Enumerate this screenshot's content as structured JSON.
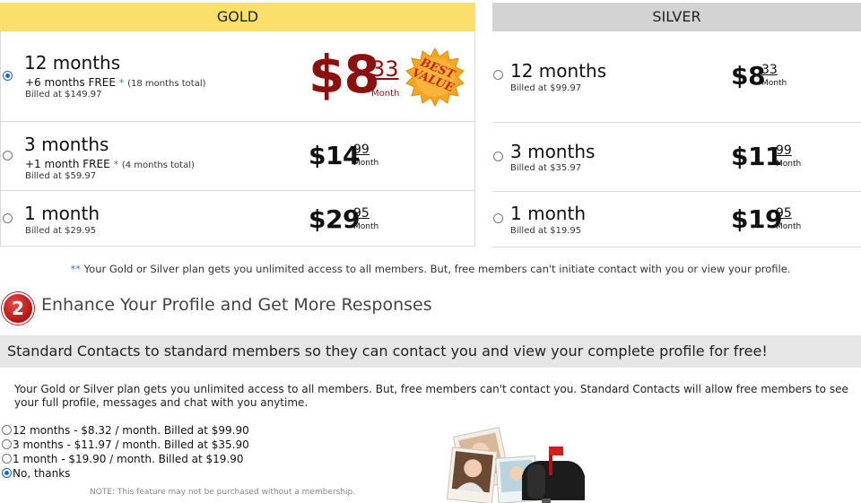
{
  "plans": {
    "gold": {
      "header": "GOLD",
      "badge_line1": "BEST",
      "badge_line2": "VALUE",
      "rows": [
        {
          "term": "12 months",
          "free_main": "+6 months FREE",
          "free_ast": "*",
          "free_total": "(18 months total)",
          "billed": "Billed at $149.97",
          "dollars": "$8",
          "cents": "33",
          "per": "Month",
          "selected": true
        },
        {
          "term": "3 months",
          "free_main": "+1 month FREE",
          "free_ast": "*",
          "free_total": "(4 months total)",
          "billed": "Billed at $59.97",
          "dollars": "$14",
          "cents": "99",
          "per": "Month",
          "selected": false
        },
        {
          "term": "1 month",
          "billed": "Billed at $29.95",
          "dollars": "$29",
          "cents": "95",
          "per": "Month",
          "selected": false
        }
      ]
    },
    "silver": {
      "header": "SILVER",
      "rows": [
        {
          "term": "12 months",
          "billed": "Billed at $99.97",
          "dollars": "$8",
          "cents": "33",
          "per": "Month",
          "selected": false
        },
        {
          "term": "3 months",
          "billed": "Billed at $35.97",
          "dollars": "$11",
          "cents": "99",
          "per": "Month",
          "selected": false
        },
        {
          "term": "1 month",
          "billed": "Billed at $19.95",
          "dollars": "$19",
          "cents": "95",
          "per": "Month",
          "selected": false
        }
      ]
    }
  },
  "footnote": {
    "ast": "**",
    "text": " Your Gold or Silver plan gets you unlimited access to all members. But, free members can't initiate contact with you or view your profile."
  },
  "step2": {
    "number": "2",
    "title": "Enhance Your Profile and Get More Responses",
    "banner": "Standard Contacts to standard members so they can contact you and view your complete profile for free!",
    "description": "Your Gold or Silver plan gets you unlimited access to all members. But, free members can't contact you. Standard Contacts will allow free members to see your full profile, messages and chat with you anytime.",
    "options": [
      {
        "label": "12 months - $8.32 / month. Billed at $99.90",
        "selected": false
      },
      {
        "label": "3 months - $11.97 / month. Billed at $35.90",
        "selected": false
      },
      {
        "label": "1 month - $19.90 / month. Billed at $19.90",
        "selected": false
      },
      {
        "label": "No, thanks",
        "selected": true
      }
    ],
    "note": "NOTE: This feature may not be purchased without a membership."
  },
  "colors": {
    "gold_header": "#fadf6b",
    "silver_header": "#d3d3d3",
    "price_highlight": "#8b1010",
    "badge_fill": "#f5a623",
    "badge_text": "#c2281d",
    "step_circle": "#c41b1b",
    "banner_bg": "#e6e6e6",
    "link_blue": "#3c78d8"
  },
  "icons": {
    "badge": "best-value-starburst",
    "promo": "mailbox-with-photos"
  }
}
